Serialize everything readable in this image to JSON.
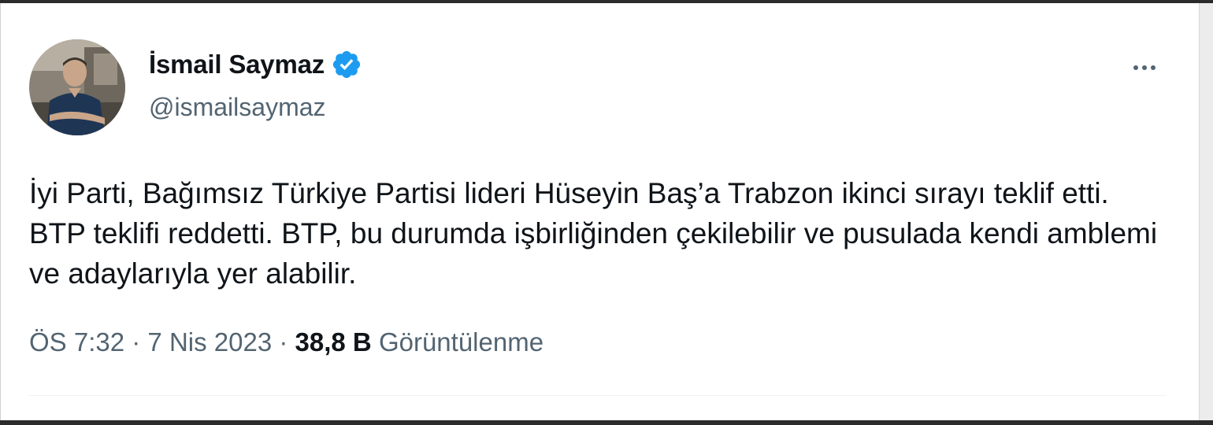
{
  "author": {
    "display_name": "İsmail Saymaz",
    "handle": "@ismailsaymaz",
    "verified": true
  },
  "tweet": {
    "text": "İyi Parti, Bağımsız Türkiye Partisi lideri Hüseyin Baş’a Trabzon ikinci sırayı teklif etti. BTP teklifi reddetti. BTP, bu durumda işbirliğinden çekilebilir ve pusulada kendi amblemi ve adaylarıyla yer alabilir.",
    "time": "ÖS 7:32",
    "separator": "·",
    "date": "7 Nis 2023",
    "views_count": "38,8 B",
    "views_label": "Görüntülenme"
  },
  "icons": {
    "verified": "verified-badge-icon",
    "more": "more-options-icon"
  },
  "colors": {
    "verified_blue": "#1d9bf0",
    "text_primary": "#0f1419",
    "text_secondary": "#536471"
  }
}
